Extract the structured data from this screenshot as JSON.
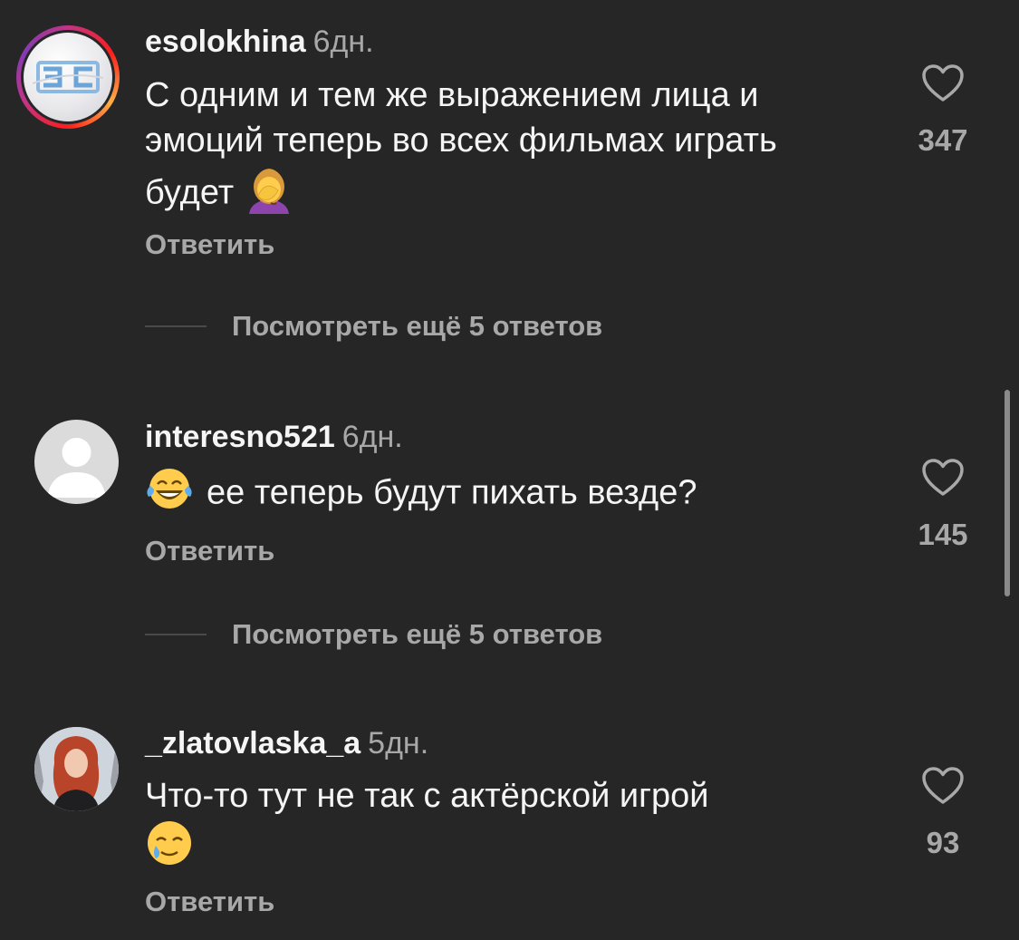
{
  "comments": [
    {
      "username": "esolokhina",
      "time": "6дн.",
      "text": "С одним и тем же выражением лица и эмоций теперь во всех фильмах играть будет",
      "emoji": "woman-facepalming",
      "reply_label": "Ответить",
      "likes": "347",
      "more_replies": "Посмотреть ещё 5 ответов",
      "avatar": "logo-ЭС"
    },
    {
      "username": "interesno521",
      "time": "6дн.",
      "text": "ее теперь будут пихать везде?",
      "emoji": "face-with-tears-of-joy",
      "reply_label": "Ответить",
      "likes": "145",
      "more_replies": "Посмотреть ещё 5 ответов",
      "avatar": "default-user"
    },
    {
      "username": "_zlatovlaska_a",
      "time": "5дн.",
      "text": "Что-то тут не так с актёрской игрой",
      "emoji": "smiling-face-with-tear",
      "reply_label": "Ответить",
      "likes": "93",
      "avatar": "photo-red-haired-woman"
    }
  ],
  "colors": {
    "background": "#262626",
    "primary_text": "#f5f5f5",
    "secondary_text": "#a8a8a8"
  }
}
